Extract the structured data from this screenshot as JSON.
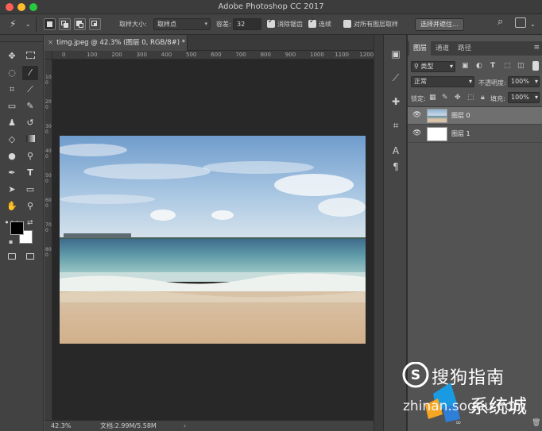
{
  "window": {
    "title": "Adobe Photoshop CC 2017"
  },
  "options_bar": {
    "tool_icon": "magic-wand-icon",
    "sample_size_label": "取样大小:",
    "sample_size_value": "取样点",
    "tolerance_label": "容差:",
    "tolerance_value": "32",
    "antialias_label": "消除锯齿",
    "contiguous_label": "连续",
    "sample_all_layers_label": "对所有图层取样",
    "select_subject_button": "选择并遮住..."
  },
  "document": {
    "tab_title": "timg.jpeg @ 42.3% (图层 0, RGB/8#) *",
    "ruler_h_ticks": [
      "0",
      "100",
      "200",
      "300",
      "400",
      "500",
      "600",
      "700",
      "800",
      "900",
      "1000",
      "1100",
      "1200"
    ],
    "ruler_v_ticks": [
      "1 0 0",
      "2 0 0",
      "3 0 0",
      "4 0 0",
      "5 0 0",
      "6 0 0",
      "7 0 0",
      "8 0 0"
    ]
  },
  "status_bar": {
    "zoom": "42.3%",
    "doc_size": "文档:2.99M/5.58M"
  },
  "layers_panel": {
    "tabs": [
      "图层",
      "通道",
      "路径"
    ],
    "active_tab": "图层",
    "filter_label": "类型",
    "blend_mode": "正常",
    "opacity_label": "不透明度:",
    "opacity_value": "100%",
    "lock_label": "锁定:",
    "fill_label": "填充:",
    "fill_value": "100%",
    "layers": [
      {
        "name": "图层 0",
        "selected": true
      },
      {
        "name": "图层 1",
        "selected": false
      }
    ]
  },
  "watermark": {
    "brand": "搜狗指南",
    "url_text": "zhinan.sogou.com",
    "site": "系统城"
  },
  "colors": {
    "foreground": "#000000",
    "background": "#ffffff",
    "accent_blue": "#1a9ae0"
  }
}
